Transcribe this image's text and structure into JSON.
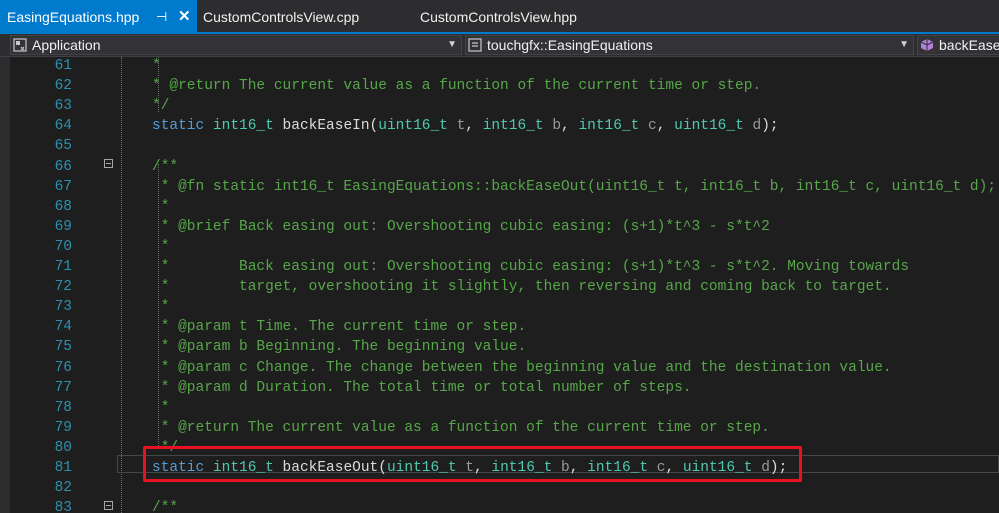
{
  "tabs": [
    {
      "label": "EasingEquations.hpp",
      "active": true
    },
    {
      "label": "CustomControlsView.cpp",
      "active": false
    },
    {
      "label": "CustomControlsView.hpp",
      "active": false
    }
  ],
  "tab_controls": {
    "pin": "⊣",
    "close": "✕"
  },
  "nav": {
    "project": "Application",
    "scope": "touchgfx::EasingEquations",
    "member": "backEaseOut"
  },
  "colors": {
    "accent": "#007acc",
    "highlight": "#e81123",
    "comment": "#57a64a",
    "keyword": "#569cd6",
    "type": "#4ec9b0",
    "line_number": "#2b91af"
  },
  "lines": [
    {
      "n": "61",
      "tokens": [
        {
          "c": "cm",
          "t": "*"
        }
      ]
    },
    {
      "n": "62",
      "tokens": [
        {
          "c": "cm",
          "t": "* @return The current value as a function of the current time or step."
        }
      ]
    },
    {
      "n": "63",
      "tokens": [
        {
          "c": "cm",
          "t": "*/"
        }
      ]
    },
    {
      "n": "64",
      "tokens": [
        {
          "c": "kw",
          "t": "static "
        },
        {
          "c": "ty",
          "t": "int16_t"
        },
        {
          "c": "tx",
          "t": " backEaseIn("
        },
        {
          "c": "ty",
          "t": "uint16_t"
        },
        {
          "c": "pa",
          "t": " t"
        },
        {
          "c": "tx",
          "t": ", "
        },
        {
          "c": "ty",
          "t": "int16_t"
        },
        {
          "c": "pa",
          "t": " b"
        },
        {
          "c": "tx",
          "t": ", "
        },
        {
          "c": "ty",
          "t": "int16_t"
        },
        {
          "c": "pa",
          "t": " c"
        },
        {
          "c": "tx",
          "t": ", "
        },
        {
          "c": "ty",
          "t": "uint16_t"
        },
        {
          "c": "pa",
          "t": " d"
        },
        {
          "c": "tx",
          "t": ");"
        }
      ]
    },
    {
      "n": "65",
      "tokens": []
    },
    {
      "n": "66",
      "tokens": [
        {
          "c": "cm",
          "t": "/**"
        }
      ]
    },
    {
      "n": "67",
      "tokens": [
        {
          "c": "cm",
          "t": " * @fn static int16_t EasingEquations::backEaseOut(uint16_t t, int16_t b, int16_t c, uint16_t d);"
        }
      ]
    },
    {
      "n": "68",
      "tokens": [
        {
          "c": "cm",
          "t": " *"
        }
      ]
    },
    {
      "n": "69",
      "tokens": [
        {
          "c": "cm",
          "t": " * @brief Back easing out: Overshooting cubic easing: (s+1)*t^3 - s*t^2"
        }
      ]
    },
    {
      "n": "70",
      "tokens": [
        {
          "c": "cm",
          "t": " *"
        }
      ]
    },
    {
      "n": "71",
      "tokens": [
        {
          "c": "cm",
          "t": " *        Back easing out: Overshooting cubic easing: (s+1)*t^3 - s*t^2. Moving towards"
        }
      ]
    },
    {
      "n": "72",
      "tokens": [
        {
          "c": "cm",
          "t": " *        target, overshooting it slightly, then reversing and coming back to target."
        }
      ]
    },
    {
      "n": "73",
      "tokens": [
        {
          "c": "cm",
          "t": " *"
        }
      ]
    },
    {
      "n": "74",
      "tokens": [
        {
          "c": "cm",
          "t": " * @param t Time. The current time or step."
        }
      ]
    },
    {
      "n": "75",
      "tokens": [
        {
          "c": "cm",
          "t": " * @param b Beginning. The beginning value."
        }
      ]
    },
    {
      "n": "76",
      "tokens": [
        {
          "c": "cm",
          "t": " * @param c Change. The change between the beginning value and the destination value."
        }
      ]
    },
    {
      "n": "77",
      "tokens": [
        {
          "c": "cm",
          "t": " * @param d Duration. The total time or total number of steps."
        }
      ]
    },
    {
      "n": "78",
      "tokens": [
        {
          "c": "cm",
          "t": " *"
        }
      ]
    },
    {
      "n": "79",
      "tokens": [
        {
          "c": "cm",
          "t": " * @return The current value as a function of the current time or step."
        }
      ]
    },
    {
      "n": "80",
      "tokens": [
        {
          "c": "cm",
          "t": " */"
        }
      ]
    },
    {
      "n": "81",
      "tokens": [
        {
          "c": "kw",
          "t": "static "
        },
        {
          "c": "ty",
          "t": "int16_t"
        },
        {
          "c": "tx",
          "t": " backEaseOut("
        },
        {
          "c": "ty",
          "t": "uint16_t"
        },
        {
          "c": "pa",
          "t": " t"
        },
        {
          "c": "tx",
          "t": ", "
        },
        {
          "c": "ty",
          "t": "int16_t"
        },
        {
          "c": "pa",
          "t": " b"
        },
        {
          "c": "tx",
          "t": ", "
        },
        {
          "c": "ty",
          "t": "int16_t"
        },
        {
          "c": "pa",
          "t": " c"
        },
        {
          "c": "tx",
          "t": ", "
        },
        {
          "c": "ty",
          "t": "uint16_t"
        },
        {
          "c": "pa",
          "t": " d"
        },
        {
          "c": "tx",
          "t": ");"
        }
      ]
    },
    {
      "n": "82",
      "tokens": []
    },
    {
      "n": "83",
      "tokens": [
        {
          "c": "cm",
          "t": "/**"
        }
      ]
    }
  ]
}
